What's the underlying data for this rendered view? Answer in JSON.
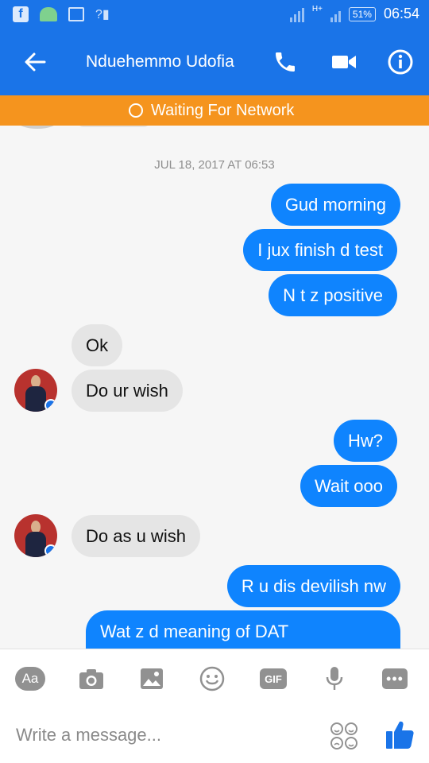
{
  "status_bar": {
    "network": "H+",
    "battery": "51%",
    "time": "06:54"
  },
  "header": {
    "title": "Nduehemmo Udofia"
  },
  "network_banner": {
    "text": "Waiting For Network"
  },
  "conversation": {
    "timestamp": "JUL 18, 2017 AT 06:53",
    "messages": [
      {
        "from": "me",
        "text": "Gud morning"
      },
      {
        "from": "me",
        "text": "I jux finish d test"
      },
      {
        "from": "me",
        "text": "N t z positive"
      },
      {
        "from": "them",
        "text": "Ok"
      },
      {
        "from": "them",
        "text": "Do ur wish"
      },
      {
        "from": "me",
        "text": "Hw?"
      },
      {
        "from": "me",
        "text": "Wait ooo"
      },
      {
        "from": "them",
        "text": "Do as u wish"
      },
      {
        "from": "me",
        "text": "R u dis devilish nw"
      },
      {
        "from": "me",
        "text": "Wat z d meaning of DAT"
      }
    ]
  },
  "toolbar": {
    "text_button": "Aa",
    "gif_button": "GIF"
  },
  "composer": {
    "placeholder": "Write a message..."
  },
  "colors": {
    "primary": "#1a74e8",
    "outgoing_bubble": "#0f84fe",
    "incoming_bubble": "#e5e5e5",
    "banner": "#f5941e"
  }
}
